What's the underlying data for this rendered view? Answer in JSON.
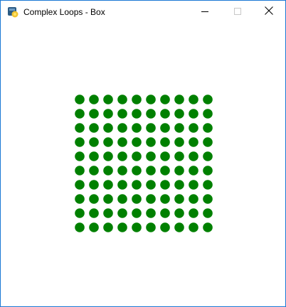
{
  "window": {
    "title": "Complex Loops - Box"
  },
  "icons": {
    "app": "python-icon",
    "minimize": "minimize-icon",
    "maximize": "maximize-icon",
    "close": "close-icon"
  },
  "grid": {
    "rows": 10,
    "columns": 10,
    "dot_color": "#008000"
  }
}
